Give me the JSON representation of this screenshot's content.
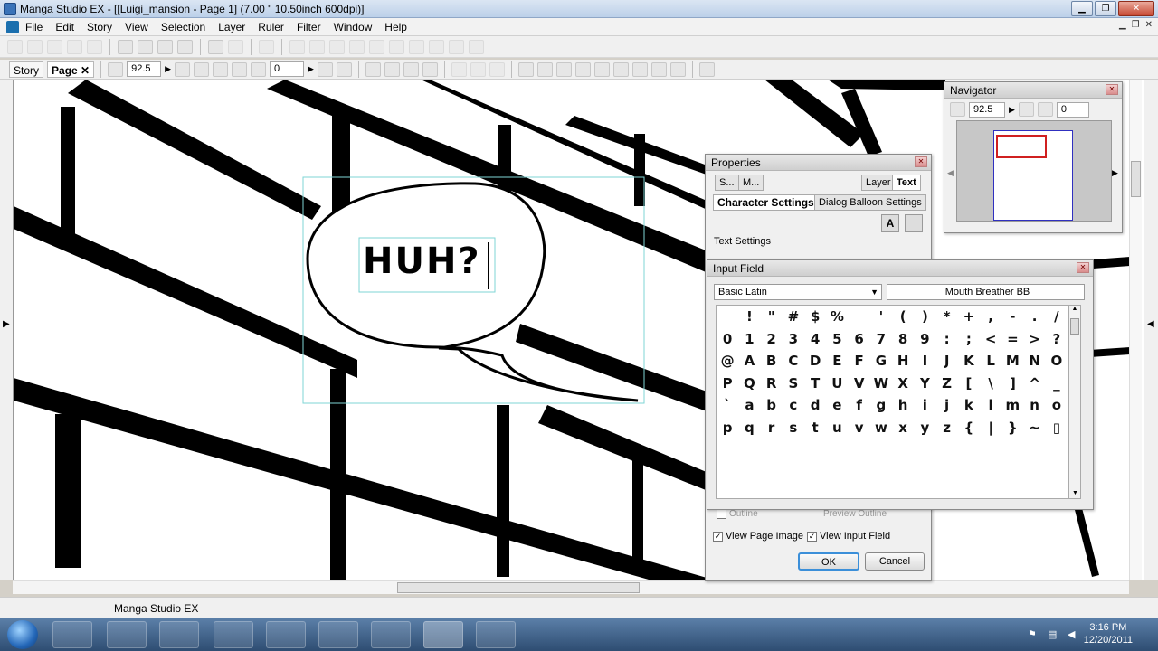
{
  "window": {
    "title": "Manga Studio EX - [[Luigi_mansion - Page 1] (7.00 \" 10.50inch 600dpi)]"
  },
  "menu": [
    "File",
    "Edit",
    "Story",
    "View",
    "Selection",
    "Layer",
    "Ruler",
    "Filter",
    "Window",
    "Help"
  ],
  "toolbar2": {
    "tabs": [
      {
        "label": "Story"
      },
      {
        "label": "Page"
      }
    ],
    "zoom": "92.5",
    "rotation": "0"
  },
  "canvas": {
    "balloon_text": "HUH?"
  },
  "navigator": {
    "title": "Navigator",
    "zoom": "92.5",
    "rotation": "0"
  },
  "properties": {
    "title": "Properties",
    "tabs": [
      "S...",
      "M...",
      "Layer",
      "Text"
    ],
    "subtabs": [
      "Character Settings",
      "Dialog Balloon Settings"
    ],
    "section": "Text Settings",
    "view_page_image": "View Page Image",
    "view_input_field": "View Input Field",
    "ok": "OK",
    "cancel": "Cancel",
    "outline": "Outline",
    "preview_outline": "Preview Outline"
  },
  "input_field": {
    "title": "Input Field",
    "charset": "Basic Latin",
    "font": "Mouth Breather BB",
    "rows": [
      [
        " ",
        "!",
        "\"",
        "#",
        "$",
        "%",
        " ",
        "'",
        "(",
        ")",
        "*",
        "+",
        ",",
        "-",
        ".",
        "/"
      ],
      [
        "0",
        "1",
        "2",
        "3",
        "4",
        "5",
        "6",
        "7",
        "8",
        "9",
        ":",
        ";",
        "<",
        "=",
        ">",
        "?"
      ],
      [
        "@",
        "A",
        "B",
        "C",
        "D",
        "E",
        "F",
        "G",
        "H",
        "I",
        "J",
        "K",
        "L",
        "M",
        "N",
        "O"
      ],
      [
        "P",
        "Q",
        "R",
        "S",
        "T",
        "U",
        "V",
        "W",
        "X",
        "Y",
        "Z",
        "[",
        "\\",
        "]",
        "^",
        "_"
      ],
      [
        "`",
        "a",
        "b",
        "c",
        "d",
        "e",
        "f",
        "g",
        "h",
        "i",
        "j",
        "k",
        "l",
        "m",
        "n",
        "o"
      ],
      [
        "p",
        "q",
        "r",
        "s",
        "t",
        "u",
        "v",
        "w",
        "x",
        "y",
        "z",
        "{",
        "|",
        "}",
        "~",
        "▯"
      ]
    ]
  },
  "status": {
    "app_name": "Manga Studio EX"
  },
  "taskbar": {
    "time": "3:16 PM",
    "date": "12/20/2011"
  }
}
